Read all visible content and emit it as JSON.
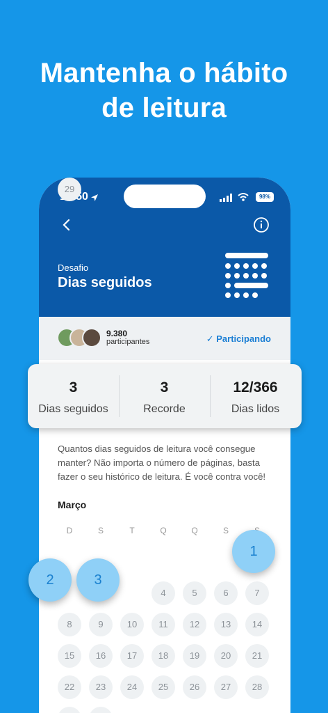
{
  "headline": {
    "line1": "Mantenha o hábito",
    "line2": "de leitura"
  },
  "status_bar": {
    "time": "13:50",
    "battery": "98%"
  },
  "header": {
    "subtitle": "Desafio",
    "title": "Dias seguidos"
  },
  "participants": {
    "count": "9.380",
    "label": "participantes",
    "status": "✓ Participando"
  },
  "stats": [
    {
      "value": "3",
      "label": "Dias seguidos"
    },
    {
      "value": "3",
      "label": "Recorde"
    },
    {
      "value": "12/366",
      "label": "Dias lidos"
    }
  ],
  "description": "Quantos dias seguidos de leitura você consegue manter? Não importa o número de páginas, basta fazer o seu histórico de leitura. É você contra você!",
  "calendar": {
    "month": "Março",
    "weekdays": [
      "D",
      "S",
      "T",
      "Q",
      "Q",
      "S",
      "S"
    ],
    "days": [
      "4",
      "5",
      "6",
      "7",
      "8",
      "9",
      "10",
      "11",
      "12",
      "13",
      "14",
      "15",
      "16",
      "17",
      "18",
      "19",
      "20",
      "21",
      "22",
      "23",
      "24",
      "25",
      "26",
      "27",
      "28",
      "29"
    ],
    "highlighted": [
      "1",
      "2",
      "3"
    ]
  },
  "colors": {
    "background": "#1596e8",
    "header": "#0b59a8",
    "accent": "#1a7ed4",
    "bubble": "#8fd0f7"
  }
}
